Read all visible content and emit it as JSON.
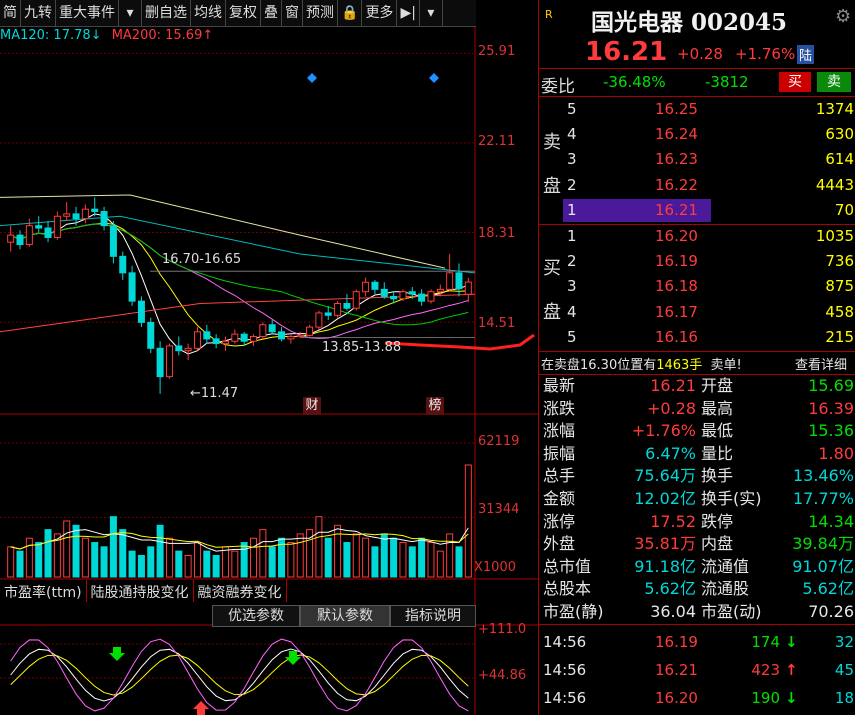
{
  "toolbar": {
    "items": [
      "简",
      "九转",
      "重大事件",
      "▾",
      "删自选",
      "均线",
      "复权",
      "叠",
      "窗",
      "预测",
      "🔒",
      "更多",
      "▶|",
      "▾"
    ]
  },
  "ma_legend": {
    "ma120": "MA120: 17.78↓",
    "ma200": "MA200: 15.69↑"
  },
  "price_axis": [
    "25.91",
    "22.11",
    "18.31",
    "14.51"
  ],
  "volume_axis": [
    "62119",
    "31344",
    "X1000"
  ],
  "indicator_axis": [
    "+111.0",
    "+44.86"
  ],
  "annotations": {
    "range_high": "16.70-16.65",
    "range_low": "13.85-13.88",
    "low_price": "←11.47",
    "mark_cai": "财",
    "mark_bang": "榜"
  },
  "tabs": [
    "市盈率(ttm)",
    "陆股通持股变化",
    "融资融券变化"
  ],
  "param_tabs": [
    "优选参数",
    "默认参数",
    "指标说明"
  ],
  "stock": {
    "badge": "R",
    "name": "国光电器 002045",
    "price": "16.21",
    "change": "+0.28",
    "pct": "+1.76%",
    "lu": "陆"
  },
  "weibi": {
    "label": "委比",
    "ratio": "-36.48%",
    "diff": "-3812",
    "buy": "买",
    "sell": "卖"
  },
  "ask_side_label": [
    "卖",
    "盘"
  ],
  "bid_side_label": [
    "买",
    "盘"
  ],
  "asks": [
    {
      "lv": "5",
      "price": "16.25",
      "vol": "1374"
    },
    {
      "lv": "4",
      "price": "16.24",
      "vol": "630"
    },
    {
      "lv": "3",
      "price": "16.23",
      "vol": "614"
    },
    {
      "lv": "2",
      "price": "16.22",
      "vol": "4443"
    },
    {
      "lv": "1",
      "price": "16.21",
      "vol": "70"
    }
  ],
  "bids": [
    {
      "lv": "1",
      "price": "16.20",
      "vol": "1035"
    },
    {
      "lv": "2",
      "price": "16.19",
      "vol": "736"
    },
    {
      "lv": "3",
      "price": "16.18",
      "vol": "875"
    },
    {
      "lv": "4",
      "price": "16.17",
      "vol": "458"
    },
    {
      "lv": "5",
      "price": "16.16",
      "vol": "215"
    }
  ],
  "notice": {
    "pre": "在卖盘16.30位置有",
    "qty": "1463手",
    "post": "卖单!",
    "link": "查看详细"
  },
  "stats": [
    {
      "l1": "最新",
      "v1": "16.21",
      "c1": "red",
      "l2": "开盘",
      "v2": "15.69",
      "c2": "green"
    },
    {
      "l1": "涨跌",
      "v1": "+0.28",
      "c1": "red",
      "l2": "最高",
      "v2": "16.39",
      "c2": "red"
    },
    {
      "l1": "涨幅",
      "v1": "+1.76%",
      "c1": "red",
      "l2": "最低",
      "v2": "15.36",
      "c2": "green"
    },
    {
      "l1": "振幅",
      "v1": "6.47%",
      "c1": "cyan",
      "l2": "量比",
      "v2": "1.80",
      "c2": "red"
    },
    {
      "l1": "总手",
      "v1": "75.64万",
      "c1": "cyan",
      "l2": "换手",
      "v2": "13.46%",
      "c2": "cyan"
    },
    {
      "l1": "金额",
      "v1": "12.02亿",
      "c1": "cyan",
      "l2": "换手(实)",
      "v2": "17.77%",
      "c2": "cyan"
    },
    {
      "l1": "涨停",
      "v1": "17.52",
      "c1": "red",
      "l2": "跌停",
      "v2": "14.34",
      "c2": "green"
    },
    {
      "l1": "外盘",
      "v1": "35.81万",
      "c1": "red",
      "l2": "内盘",
      "v2": "39.84万",
      "c2": "green"
    },
    {
      "l1": "总市值",
      "v1": "91.18亿",
      "c1": "cyan",
      "l2": "流通值",
      "v2": "91.07亿",
      "c2": "cyan"
    },
    {
      "l1": "总股本",
      "v1": "5.62亿",
      "c1": "cyan",
      "l2": "流通股",
      "v2": "5.62亿",
      "c2": "cyan"
    },
    {
      "l1": "市盈(静)",
      "v1": "36.04",
      "c1": "white",
      "l2": "市盈(动)",
      "v2": "70.26",
      "c2": "white"
    }
  ],
  "ticks": [
    {
      "time": "14:56",
      "price": "16.19",
      "vol": "174",
      "dir": "down",
      "n": "32"
    },
    {
      "time": "14:56",
      "price": "16.21",
      "vol": "423",
      "dir": "up",
      "n": "45"
    },
    {
      "time": "14:56",
      "price": "16.20",
      "vol": "190",
      "dir": "down",
      "n": "18"
    }
  ],
  "colors": {
    "up": "#ff3b3b",
    "down": "#00e000",
    "ma1": "#ffffff",
    "ma2": "#ffff00",
    "ma3": "#ff66ff",
    "ma4": "#00cc00",
    "ma5": "#00bbbb",
    "ma6": "#ff4444"
  },
  "chart_data": {
    "type": "candlestick",
    "candles": [
      {
        "o": 17.9,
        "h": 18.6,
        "l": 17.5,
        "c": 18.2
      },
      {
        "o": 18.2,
        "h": 18.4,
        "l": 17.6,
        "c": 17.8
      },
      {
        "o": 17.8,
        "h": 18.9,
        "l": 17.7,
        "c": 18.6
      },
      {
        "o": 18.6,
        "h": 19.0,
        "l": 18.3,
        "c": 18.5
      },
      {
        "o": 18.5,
        "h": 18.8,
        "l": 17.9,
        "c": 18.1
      },
      {
        "o": 18.1,
        "h": 19.2,
        "l": 18.0,
        "c": 19.0
      },
      {
        "o": 19.0,
        "h": 19.6,
        "l": 18.8,
        "c": 19.1
      },
      {
        "o": 19.1,
        "h": 19.4,
        "l": 18.6,
        "c": 18.9
      },
      {
        "o": 18.9,
        "h": 19.5,
        "l": 18.7,
        "c": 19.3
      },
      {
        "o": 19.3,
        "h": 19.8,
        "l": 19.0,
        "c": 19.2
      },
      {
        "o": 19.2,
        "h": 19.4,
        "l": 18.4,
        "c": 18.6
      },
      {
        "o": 18.6,
        "h": 18.8,
        "l": 17.0,
        "c": 17.3
      },
      {
        "o": 17.3,
        "h": 17.5,
        "l": 16.3,
        "c": 16.6
      },
      {
        "o": 16.6,
        "h": 16.9,
        "l": 15.2,
        "c": 15.4
      },
      {
        "o": 15.4,
        "h": 15.6,
        "l": 14.3,
        "c": 14.5
      },
      {
        "o": 14.5,
        "h": 14.7,
        "l": 13.2,
        "c": 13.4
      },
      {
        "o": 13.4,
        "h": 13.7,
        "l": 11.47,
        "c": 12.2
      },
      {
        "o": 12.2,
        "h": 13.6,
        "l": 12.1,
        "c": 13.5
      },
      {
        "o": 13.5,
        "h": 13.9,
        "l": 13.1,
        "c": 13.3
      },
      {
        "o": 13.3,
        "h": 13.6,
        "l": 12.9,
        "c": 13.4
      },
      {
        "o": 13.4,
        "h": 14.3,
        "l": 13.3,
        "c": 14.1
      },
      {
        "o": 14.1,
        "h": 14.4,
        "l": 13.6,
        "c": 13.8
      },
      {
        "o": 13.8,
        "h": 14.0,
        "l": 13.4,
        "c": 13.6
      },
      {
        "o": 13.6,
        "h": 13.9,
        "l": 13.3,
        "c": 13.7
      },
      {
        "o": 13.7,
        "h": 14.2,
        "l": 13.6,
        "c": 14.0
      },
      {
        "o": 14.0,
        "h": 14.1,
        "l": 13.5,
        "c": 13.7
      },
      {
        "o": 13.7,
        "h": 14.0,
        "l": 13.5,
        "c": 13.9
      },
      {
        "o": 13.9,
        "h": 14.5,
        "l": 13.8,
        "c": 14.4
      },
      {
        "o": 14.4,
        "h": 14.6,
        "l": 14.0,
        "c": 14.1
      },
      {
        "o": 14.1,
        "h": 14.3,
        "l": 13.7,
        "c": 13.8
      },
      {
        "o": 13.8,
        "h": 14.0,
        "l": 13.6,
        "c": 13.9
      },
      {
        "o": 13.9,
        "h": 14.1,
        "l": 13.85,
        "c": 13.95
      },
      {
        "o": 13.95,
        "h": 14.4,
        "l": 13.9,
        "c": 14.3
      },
      {
        "o": 14.3,
        "h": 15.0,
        "l": 14.2,
        "c": 14.9
      },
      {
        "o": 14.9,
        "h": 15.2,
        "l": 14.6,
        "c": 14.8
      },
      {
        "o": 14.8,
        "h": 15.4,
        "l": 14.7,
        "c": 15.3
      },
      {
        "o": 15.3,
        "h": 15.7,
        "l": 15.0,
        "c": 15.1
      },
      {
        "o": 15.1,
        "h": 15.9,
        "l": 15.0,
        "c": 15.8
      },
      {
        "o": 15.8,
        "h": 16.4,
        "l": 15.6,
        "c": 16.2
      },
      {
        "o": 16.2,
        "h": 16.3,
        "l": 15.7,
        "c": 15.9
      },
      {
        "o": 15.9,
        "h": 16.2,
        "l": 15.5,
        "c": 15.6
      },
      {
        "o": 15.6,
        "h": 15.8,
        "l": 15.3,
        "c": 15.5
      },
      {
        "o": 15.5,
        "h": 15.9,
        "l": 15.4,
        "c": 15.8
      },
      {
        "o": 15.8,
        "h": 16.0,
        "l": 15.5,
        "c": 15.7
      },
      {
        "o": 15.7,
        "h": 15.9,
        "l": 15.2,
        "c": 15.4
      },
      {
        "o": 15.4,
        "h": 15.9,
        "l": 15.3,
        "c": 15.8
      },
      {
        "o": 15.8,
        "h": 16.1,
        "l": 15.6,
        "c": 15.9
      },
      {
        "o": 15.9,
        "h": 17.4,
        "l": 15.8,
        "c": 16.6
      },
      {
        "o": 16.6,
        "h": 17.0,
        "l": 15.6,
        "c": 15.93
      },
      {
        "o": 15.69,
        "h": 16.39,
        "l": 15.36,
        "c": 16.21
      }
    ],
    "volumes": [
      14,
      12,
      18,
      16,
      22,
      20,
      26,
      24,
      18,
      16,
      14,
      28,
      22,
      12,
      10,
      14,
      24,
      18,
      12,
      10,
      16,
      12,
      10,
      14,
      12,
      16,
      18,
      22,
      14,
      18,
      16,
      20,
      22,
      28,
      18,
      24,
      16,
      20,
      18,
      14,
      20,
      18,
      16,
      14,
      18,
      16,
      12,
      20,
      14,
      52
    ],
    "price_ylim": [
      10.7,
      26.6
    ],
    "volume_ylim": [
      0,
      62119
    ]
  }
}
